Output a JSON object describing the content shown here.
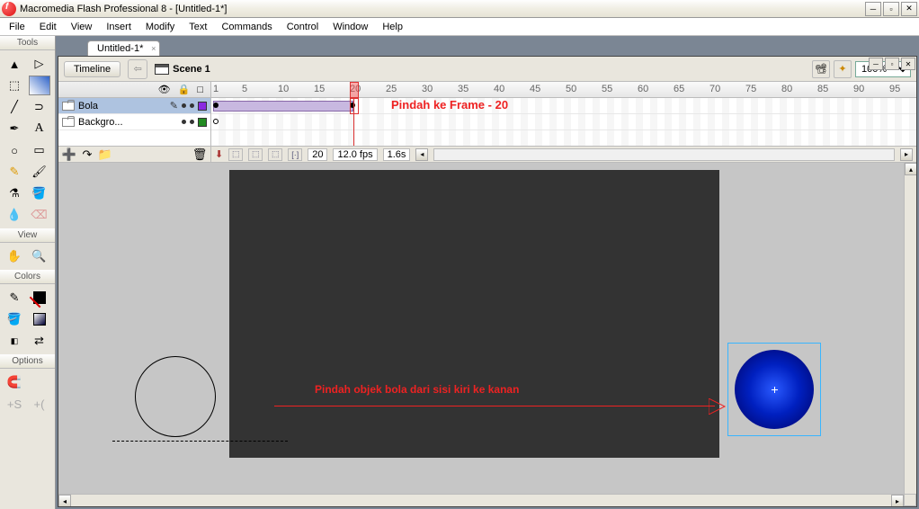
{
  "title": "Macromedia Flash Professional 8 - [Untitled-1*]",
  "menu": {
    "file": "File",
    "edit": "Edit",
    "view": "View",
    "insert": "Insert",
    "modify": "Modify",
    "text": "Text",
    "commands": "Commands",
    "control": "Control",
    "window": "Window",
    "help": "Help"
  },
  "panels": {
    "tools": "Tools",
    "view": "View",
    "colors": "Colors",
    "options": "Options"
  },
  "document": {
    "tab": "Untitled-1*",
    "timeline_btn": "Timeline",
    "scene": "Scene 1",
    "zoom": "100%"
  },
  "layer_header": {
    "eye": "👁",
    "lock": "🔒",
    "outline": "□"
  },
  "layers": [
    {
      "name": "Bola",
      "color": "#8a2be2",
      "selected": true
    },
    {
      "name": "Backgro...",
      "color": "#228b22",
      "selected": false
    }
  ],
  "timeline": {
    "ruler": [
      "1",
      "5",
      "10",
      "15",
      "20",
      "25",
      "30",
      "35",
      "40",
      "45",
      "50",
      "55",
      "60",
      "65",
      "70",
      "75",
      "80",
      "85",
      "90",
      "95"
    ],
    "frame": "20",
    "fps": "12.0 fps",
    "time": "1.6s"
  },
  "annotations": {
    "a1": "Pindah ke Frame - 20",
    "a2": "Pindah objek bola dari sisi kiri ke kanan"
  },
  "colors": {
    "stroke": "#000000",
    "fill": "#d11"
  }
}
